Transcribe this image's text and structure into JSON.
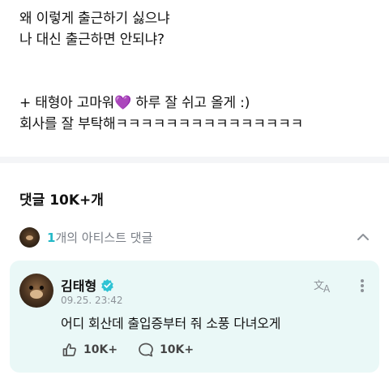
{
  "post": {
    "lines": [
      "왜 이렇게 출근하기 싫으냐",
      "나 대신 출근하면 안되냐?"
    ],
    "line3_before_emoji": "+ 태형아 고마워",
    "heart_emoji": "💜",
    "line3_after_emoji": " 하루 잘 쉬고 올게 :)",
    "line4": "회사를 잘 부탁해ㅋㅋㅋㅋㅋㅋㅋㅋㅋㅋㅋㅋㅋㅋㅋ"
  },
  "comments_header": {
    "label": "댓글",
    "count": "10K+",
    "suffix": "개"
  },
  "artist_comments": {
    "count": "1",
    "label": "개의 아티스트 댓글"
  },
  "comment": {
    "author": "김태형",
    "timestamp": "09.25. 23:42",
    "text": "어디 회산데 출입증부터 줘 소풍 다녀오게",
    "likes": "10K+",
    "replies": "10K+"
  },
  "colors": {
    "accent": "#22b8c7",
    "card_bg": "#eaf8f7",
    "verified": "#2fc3d4"
  },
  "icons": {
    "heart": "purple-heart-emoji",
    "chevron": "chevron-up-icon",
    "verified": "verified-badge-icon",
    "translate": "translate-icon",
    "more": "more-vertical-icon",
    "like": "like-icon",
    "reply": "reply-bubble-icon"
  }
}
